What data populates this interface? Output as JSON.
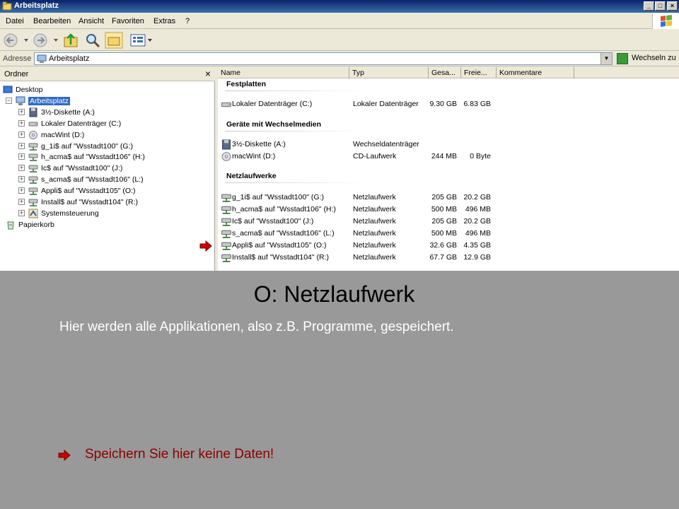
{
  "window": {
    "title": "Arbeitsplatz",
    "controls": [
      "_",
      "□",
      "×"
    ]
  },
  "menu": [
    "Datei",
    "Bearbeiten",
    "Ansicht",
    "Favoriten",
    "Extras",
    "?"
  ],
  "address": {
    "label": "Adresse",
    "value": "Arbeitsplatz",
    "go_label": "Wechseln zu"
  },
  "folders": {
    "title": "Ordner",
    "close": "×",
    "items": [
      {
        "label": "Desktop",
        "icon": "desktop-icon"
      },
      {
        "label": "Arbeitsplatz",
        "icon": "computer-icon",
        "selected": true
      },
      {
        "label": "3½-Diskette (A:)",
        "icon": "floppy-icon"
      },
      {
        "label": "Lokaler Datenträger (C:)",
        "icon": "harddisk-icon"
      },
      {
        "label": "macWint (D:)",
        "icon": "cdrom-icon"
      },
      {
        "label": "g_1i$ auf \"Wsstadt100\" (G:)",
        "icon": "network-drive-icon"
      },
      {
        "label": "h_acma$ auf \"Wsstadt106\" (H:)",
        "icon": "network-drive-icon"
      },
      {
        "label": "Ic$ auf \"Wsstadt100\" (J:)",
        "icon": "network-drive-icon"
      },
      {
        "label": "s_acma$ auf \"Wsstadt106\" (L:)",
        "icon": "network-drive-icon"
      },
      {
        "label": "Appli$ auf \"Wsstadt105\" (O:)",
        "icon": "network-drive-icon"
      },
      {
        "label": "Install$ auf \"Wsstadt104\" (R:)",
        "icon": "network-drive-icon"
      },
      {
        "label": "Systemsteuerung",
        "icon": "control-panel-icon"
      },
      {
        "label": "Papierkorb",
        "icon": "recycle-bin-icon"
      }
    ]
  },
  "list": {
    "columns": [
      "Name",
      "Typ",
      "Gesa...",
      "Freie...",
      "Kommentare"
    ],
    "groups": [
      {
        "title": "Festplatten",
        "rows": [
          {
            "name": "Lokaler Datenträger (C:)",
            "type": "Lokaler Datenträger",
            "total": "9.30 GB",
            "free": "6.83 GB",
            "icon": "harddisk-icon"
          }
        ]
      },
      {
        "title": "Geräte mit Wechselmedien",
        "rows": [
          {
            "name": "3½-Diskette (A:)",
            "type": "Wechseldatenträger",
            "total": "",
            "free": "",
            "icon": "floppy-icon"
          },
          {
            "name": "macWint (D:)",
            "type": "CD-Laufwerk",
            "total": "244 MB",
            "free": "0 Byte",
            "icon": "cdrom-icon"
          }
        ]
      },
      {
        "title": "Netzlaufwerke",
        "rows": [
          {
            "name": "g_1i$ auf \"Wsstadt100\" (G:)",
            "type": "Netzlaufwerk",
            "total": "205 GB",
            "free": "20.2 GB",
            "icon": "network-drive-icon"
          },
          {
            "name": "h_acma$ auf \"Wsstadt106\" (H:)",
            "type": "Netzlaufwerk",
            "total": "500 MB",
            "free": "496 MB",
            "icon": "network-drive-icon"
          },
          {
            "name": "Ic$ auf \"Wsstadt100\" (J:)",
            "type": "Netzlaufwerk",
            "total": "205 GB",
            "free": "20.2 GB",
            "icon": "network-drive-icon"
          },
          {
            "name": "s_acma$ auf \"Wsstadt106\" (L:)",
            "type": "Netzlaufwerk",
            "total": "500 MB",
            "free": "496 MB",
            "icon": "network-drive-icon"
          },
          {
            "name": "Appli$ auf \"Wsstadt105\" (O:)",
            "type": "Netzlaufwerk",
            "total": "32.6 GB",
            "free": "4.35 GB",
            "icon": "network-drive-icon"
          },
          {
            "name": "Install$ auf \"Wsstadt104\" (R:)",
            "type": "Netzlaufwerk",
            "total": "67.7 GB",
            "free": "12.9 GB",
            "icon": "network-drive-icon"
          }
        ]
      }
    ]
  },
  "slide": {
    "title": "O: Netzlaufwerk",
    "subtitle": "Hier werden alle Applikationen, also z.B. Programme, gespeichert.",
    "warning": "Speichern Sie hier keine Daten!"
  },
  "colors": {
    "slide_background": "#999999",
    "title_bar": "#0a246a",
    "selection": "#316ac5",
    "warning_text": "#8b0000",
    "marker_arrow": "#cc0000"
  }
}
